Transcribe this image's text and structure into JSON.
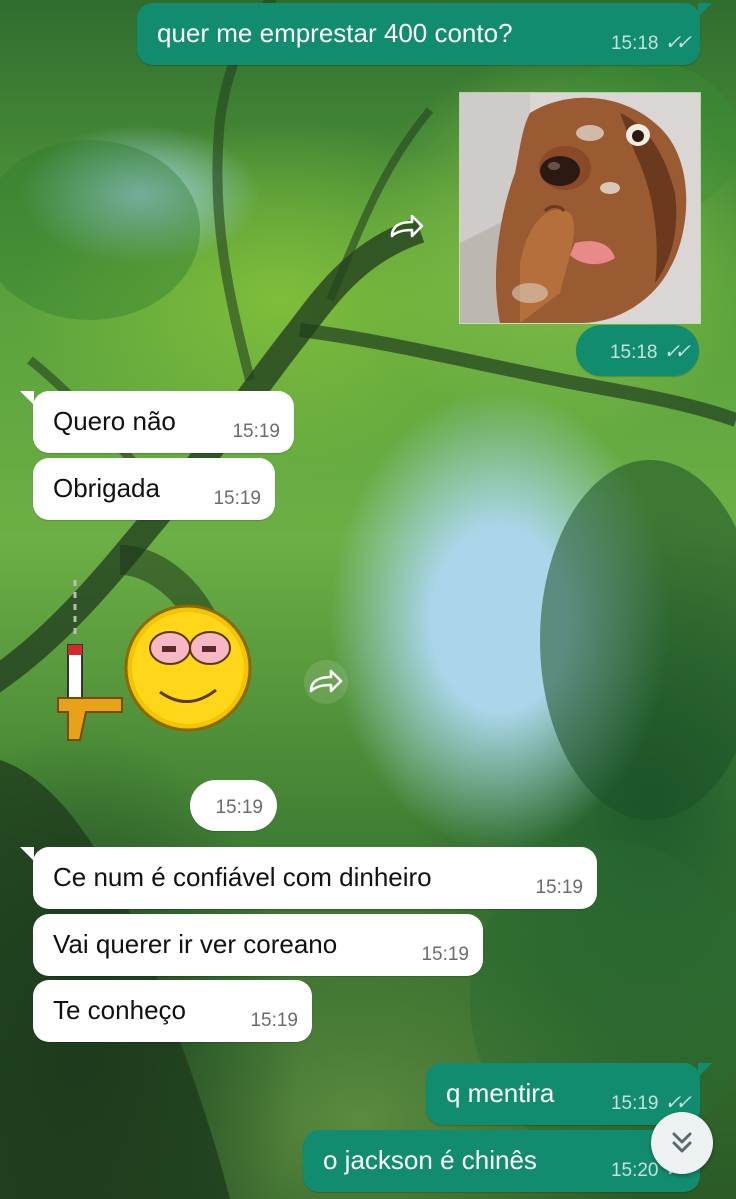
{
  "messages": [
    {
      "text": "quer me emprestar 400 conto?",
      "time": "15:18"
    },
    {
      "time": "15:18"
    },
    {
      "text": "Quero não",
      "time": "15:19"
    },
    {
      "text": "Obrigada",
      "time": "15:19"
    },
    {
      "time": "15:19"
    },
    {
      "text": "Ce num é confiável com dinheiro",
      "time": "15:19"
    },
    {
      "text": "Vai querer ir ver coreano",
      "time": "15:19"
    },
    {
      "text": "Te conheço",
      "time": "15:19"
    },
    {
      "text": "q mentira",
      "time": "15:19"
    },
    {
      "text": "o jackson é chinês",
      "time": "15:20"
    }
  ],
  "icons": {
    "read_receipt": "double-check-icon",
    "forward": "forward-arrow-icon",
    "scroll_down": "double-chevron-down-icon",
    "sticker": "smiley-sticker"
  },
  "colors": {
    "outgoing_bubble": "#128c6e",
    "incoming_bubble": "#ffffff",
    "timestamp_in": "#6c6c6c"
  }
}
